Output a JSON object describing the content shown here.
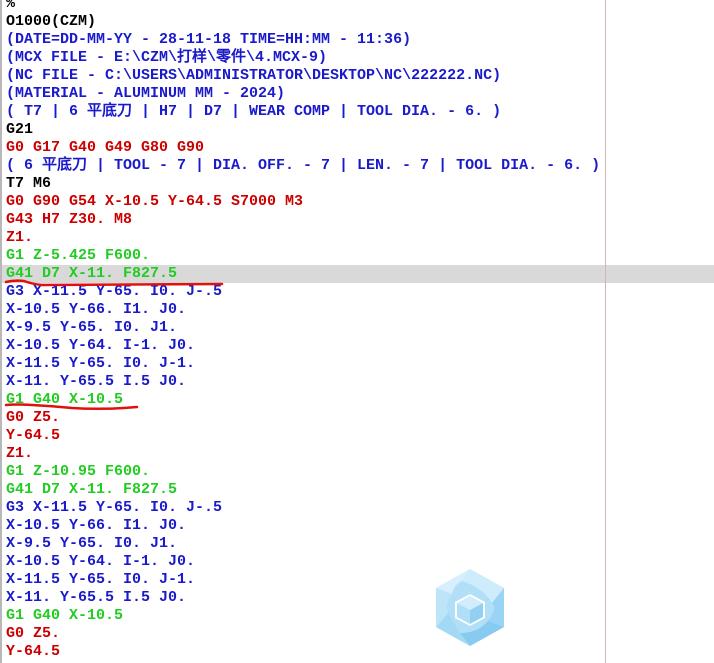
{
  "editor": {
    "lines": [
      {
        "text": "%",
        "color": "black"
      },
      {
        "text": "O1000(CZM)",
        "color": "black"
      },
      {
        "text": "(DATE=DD-MM-YY - 28-11-18 TIME=HH:MM - 11:36)",
        "color": "blue"
      },
      {
        "text": "(MCX FILE - E:\\CZM\\打样\\零件\\4.MCX-9)",
        "color": "blue"
      },
      {
        "text": "(NC FILE - C:\\USERS\\ADMINISTRATOR\\DESKTOP\\NC\\222222.NC)",
        "color": "blue"
      },
      {
        "text": "(MATERIAL - ALUMINUM MM - 2024)",
        "color": "blue"
      },
      {
        "text": "( T7 | 6 平底刀 | H7 | D7 | WEAR COMP | TOOL DIA. - 6. )",
        "color": "blue"
      },
      {
        "text": "G21",
        "color": "black"
      },
      {
        "text": "G0 G17 G40 G49 G80 G90",
        "color": "red"
      },
      {
        "text": "( 6 平底刀 | TOOL - 7 | DIA. OFF. - 7 | LEN. - 7 | TOOL DIA. - 6. )",
        "color": "blue"
      },
      {
        "text": "T7 M6",
        "color": "black"
      },
      {
        "text": "G0 G90 G54 X-10.5 Y-64.5 S7000 M3",
        "color": "red"
      },
      {
        "text": "G43 H7 Z30. M8",
        "color": "red"
      },
      {
        "text": "Z1.",
        "color": "red"
      },
      {
        "text": "G1 Z-5.425 F600.",
        "color": "green"
      },
      {
        "text": "G41 D7 X-11. F827.5",
        "color": "green",
        "highlighted": true
      },
      {
        "text": "G3 X-11.5 Y-65. I0. J-.5",
        "color": "blue"
      },
      {
        "text": "X-10.5 Y-66. I1. J0.",
        "color": "blue"
      },
      {
        "text": "X-9.5 Y-65. I0. J1.",
        "color": "blue"
      },
      {
        "text": "X-10.5 Y-64. I-1. J0.",
        "color": "blue"
      },
      {
        "text": "X-11.5 Y-65. I0. J-1.",
        "color": "blue"
      },
      {
        "text": "X-11. Y-65.5 I.5 J0.",
        "color": "blue"
      },
      {
        "text": "G1 G40 X-10.5",
        "color": "green"
      },
      {
        "text": "G0 Z5.",
        "color": "red"
      },
      {
        "text": "Y-64.5",
        "color": "red"
      },
      {
        "text": "Z1.",
        "color": "red"
      },
      {
        "text": "G1 Z-10.95 F600.",
        "color": "green"
      },
      {
        "text": "G41 D7 X-11. F827.5",
        "color": "green"
      },
      {
        "text": "G3 X-11.5 Y-65. I0. J-.5",
        "color": "blue"
      },
      {
        "text": "X-10.5 Y-66. I1. J0.",
        "color": "blue"
      },
      {
        "text": "X-9.5 Y-65. I0. J1.",
        "color": "blue"
      },
      {
        "text": "X-10.5 Y-64. I-1. J0.",
        "color": "blue"
      },
      {
        "text": "X-11.5 Y-65. I0. J-1.",
        "color": "blue"
      },
      {
        "text": "X-11. Y-65.5 I.5 J0.",
        "color": "blue"
      },
      {
        "text": "G1 G40 X-10.5",
        "color": "green"
      },
      {
        "text": "G0 Z5.",
        "color": "red"
      },
      {
        "text": "Y-64.5",
        "color": "red"
      }
    ]
  },
  "colors": {
    "black": "#000000",
    "blue": "#1a1acc",
    "red": "#cc0000",
    "green": "#22cc22",
    "highlight": "#d9d9d9",
    "annotation": "#e01010",
    "margin_line": "#d6b4b4"
  },
  "annotations": [
    {
      "type": "underline",
      "target_line": "G41 D7 X-11. F827.5"
    },
    {
      "type": "underline",
      "target_line": "G1 G40 X-10.5"
    }
  ],
  "watermark": {
    "icon": "cube-hexagon-logo-icon"
  }
}
